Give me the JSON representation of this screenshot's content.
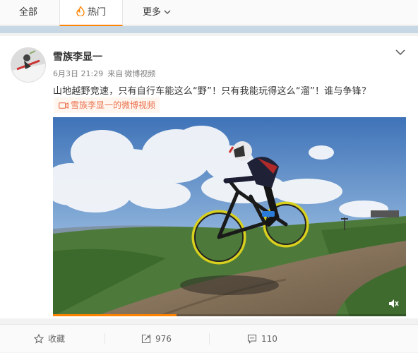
{
  "tabs": {
    "all": "全部",
    "hot": "热门",
    "more": "更多"
  },
  "post": {
    "author": "雪族李显一",
    "date": "6月3日 21:29",
    "source_prefix": "来自",
    "source": "微博视频",
    "text": "山地越野竞速，只有自行车能这么“野”！只有我能玩得这么“溜”！谁与争锋？",
    "video_link": "雪族李显一的微博视频",
    "video_progress": 0.35
  },
  "actions": {
    "favorite": "收藏",
    "repost_count": "976",
    "comment_count": "110"
  },
  "colors": {
    "accent": "#ff8200",
    "link": "#eb7350"
  },
  "icons": [
    "fire-icon",
    "chevron-down-icon",
    "video-icon",
    "mute-icon",
    "star-icon",
    "repost-icon",
    "comment-icon"
  ]
}
